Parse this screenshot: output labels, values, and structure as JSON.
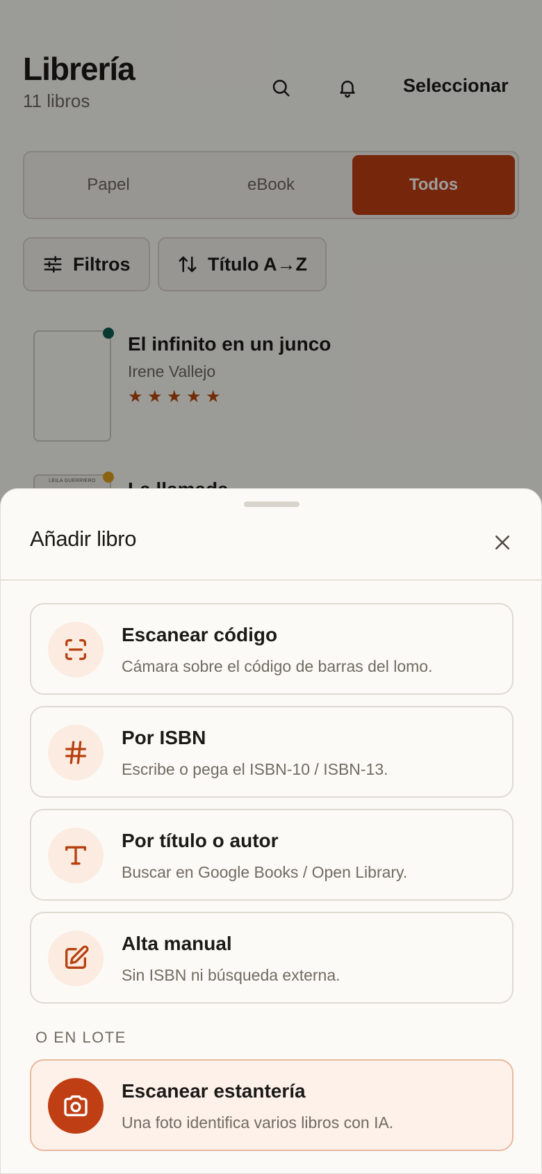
{
  "header": {
    "title": "Librería",
    "subtitle": "11 libros",
    "select_label": "Seleccionar",
    "icons": [
      "search-icon",
      "bell-icon"
    ]
  },
  "tabs": [
    {
      "label": "Papel",
      "active": false
    },
    {
      "label": "eBook",
      "active": false
    },
    {
      "label": "Todos",
      "active": true
    }
  ],
  "filters": {
    "filter_label": "Filtros",
    "sort_label": "Título A→Z"
  },
  "books": [
    {
      "title": "El infinito en un junco",
      "author": "Irene Vallejo",
      "rating": 5,
      "status_color": "#0e5e52"
    },
    {
      "title": "La llamada",
      "cover_text": "LEILA GUERRIERO",
      "status_color": "#e0a21c"
    }
  ],
  "sheet": {
    "title": "Añadir libro",
    "options": [
      {
        "title": "Escanear código",
        "desc": "Cámara sobre el código de barras del lomo.",
        "icon": "scan-icon"
      },
      {
        "title": "Por ISBN",
        "desc": "Escribe o pega el ISBN-10 / ISBN-13.",
        "icon": "hash-icon"
      },
      {
        "title": "Por título o autor",
        "desc": "Buscar en Google Books / Open Library.",
        "icon": "type-icon"
      },
      {
        "title": "Alta manual",
        "desc": "Sin ISBN ni búsqueda externa.",
        "icon": "edit-icon"
      }
    ],
    "batch_label": "O EN LOTE",
    "batch_option": {
      "title": "Escanear estantería",
      "desc": "Una foto identifica varios libros con IA.",
      "icon": "camera-icon"
    }
  },
  "colors": {
    "accent": "#bf3e13",
    "accent_soft": "#fcebe0",
    "background": "#fbfaf6",
    "star": "#b6490d"
  }
}
